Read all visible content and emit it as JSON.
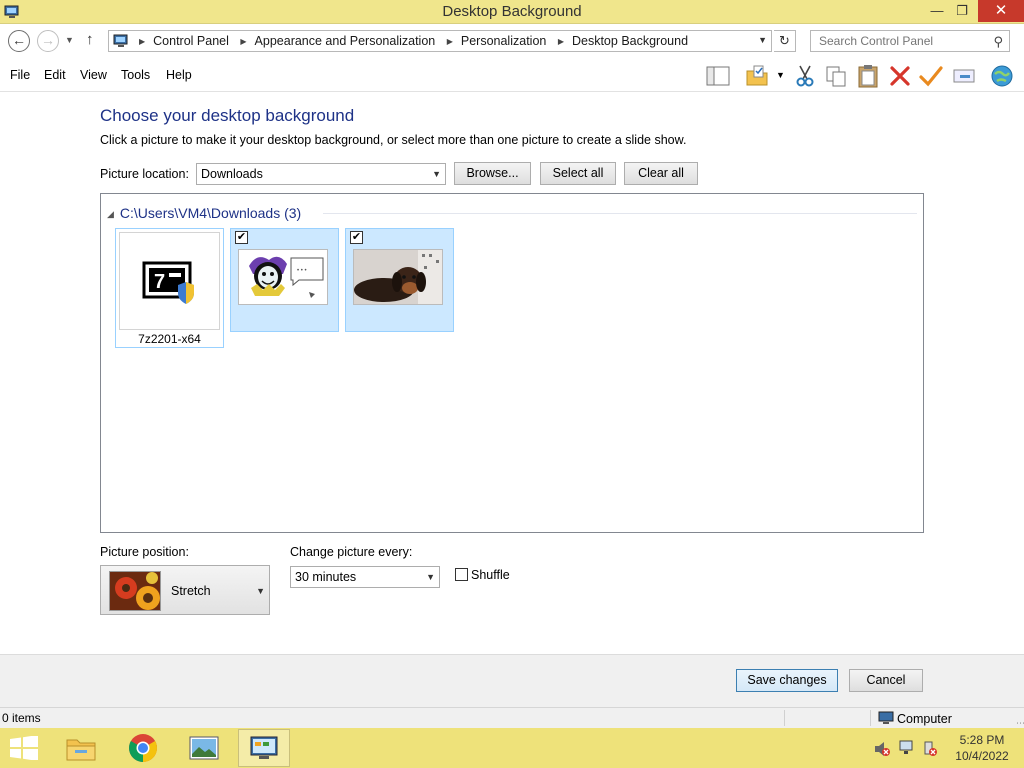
{
  "window": {
    "title": "Desktop Background",
    "minimize_glyph": "—",
    "maximize_glyph": "❐",
    "close_glyph": "✕"
  },
  "address_bar": {
    "crumbs": [
      "Control Panel",
      "Appearance and Personalization",
      "Personalization",
      "Desktop Background"
    ],
    "search_placeholder": "Search Control Panel"
  },
  "menu": {
    "items": [
      "File",
      "Edit",
      "View",
      "Tools",
      "Help"
    ]
  },
  "content": {
    "heading": "Choose your desktop background",
    "subtext": "Click a picture to make it your desktop background, or select more than one picture to create a slide show.",
    "picture_location_label": "Picture location:",
    "picture_location_value": "Downloads",
    "browse_button": "Browse...",
    "select_all_button": "Select all",
    "clear_all_button": "Clear all",
    "group_header": "C:\\Users\\VM4\\Downloads (3)",
    "pictures": [
      {
        "caption": "7z2201-x64",
        "checked": false
      },
      {
        "caption": "",
        "checked": true
      },
      {
        "caption": "",
        "checked": true
      }
    ],
    "picture_position_label": "Picture position:",
    "picture_position_value": "Stretch",
    "change_picture_label": "Change picture every:",
    "change_picture_value": "30 minutes",
    "shuffle_label": "Shuffle",
    "shuffle_checked": false
  },
  "footer": {
    "save_button": "Save changes",
    "cancel_button": "Cancel"
  },
  "status_bar": {
    "items_count": "0 items",
    "location": "Computer"
  },
  "taskbar": {
    "time": "5:28 PM",
    "date": "10/4/2022"
  },
  "colors": {
    "title_bar": "#f0e68c",
    "taskbar": "#eee27a",
    "heading_blue": "#1e3287",
    "selection": "#cce8ff",
    "close_red": "#c7392b"
  }
}
